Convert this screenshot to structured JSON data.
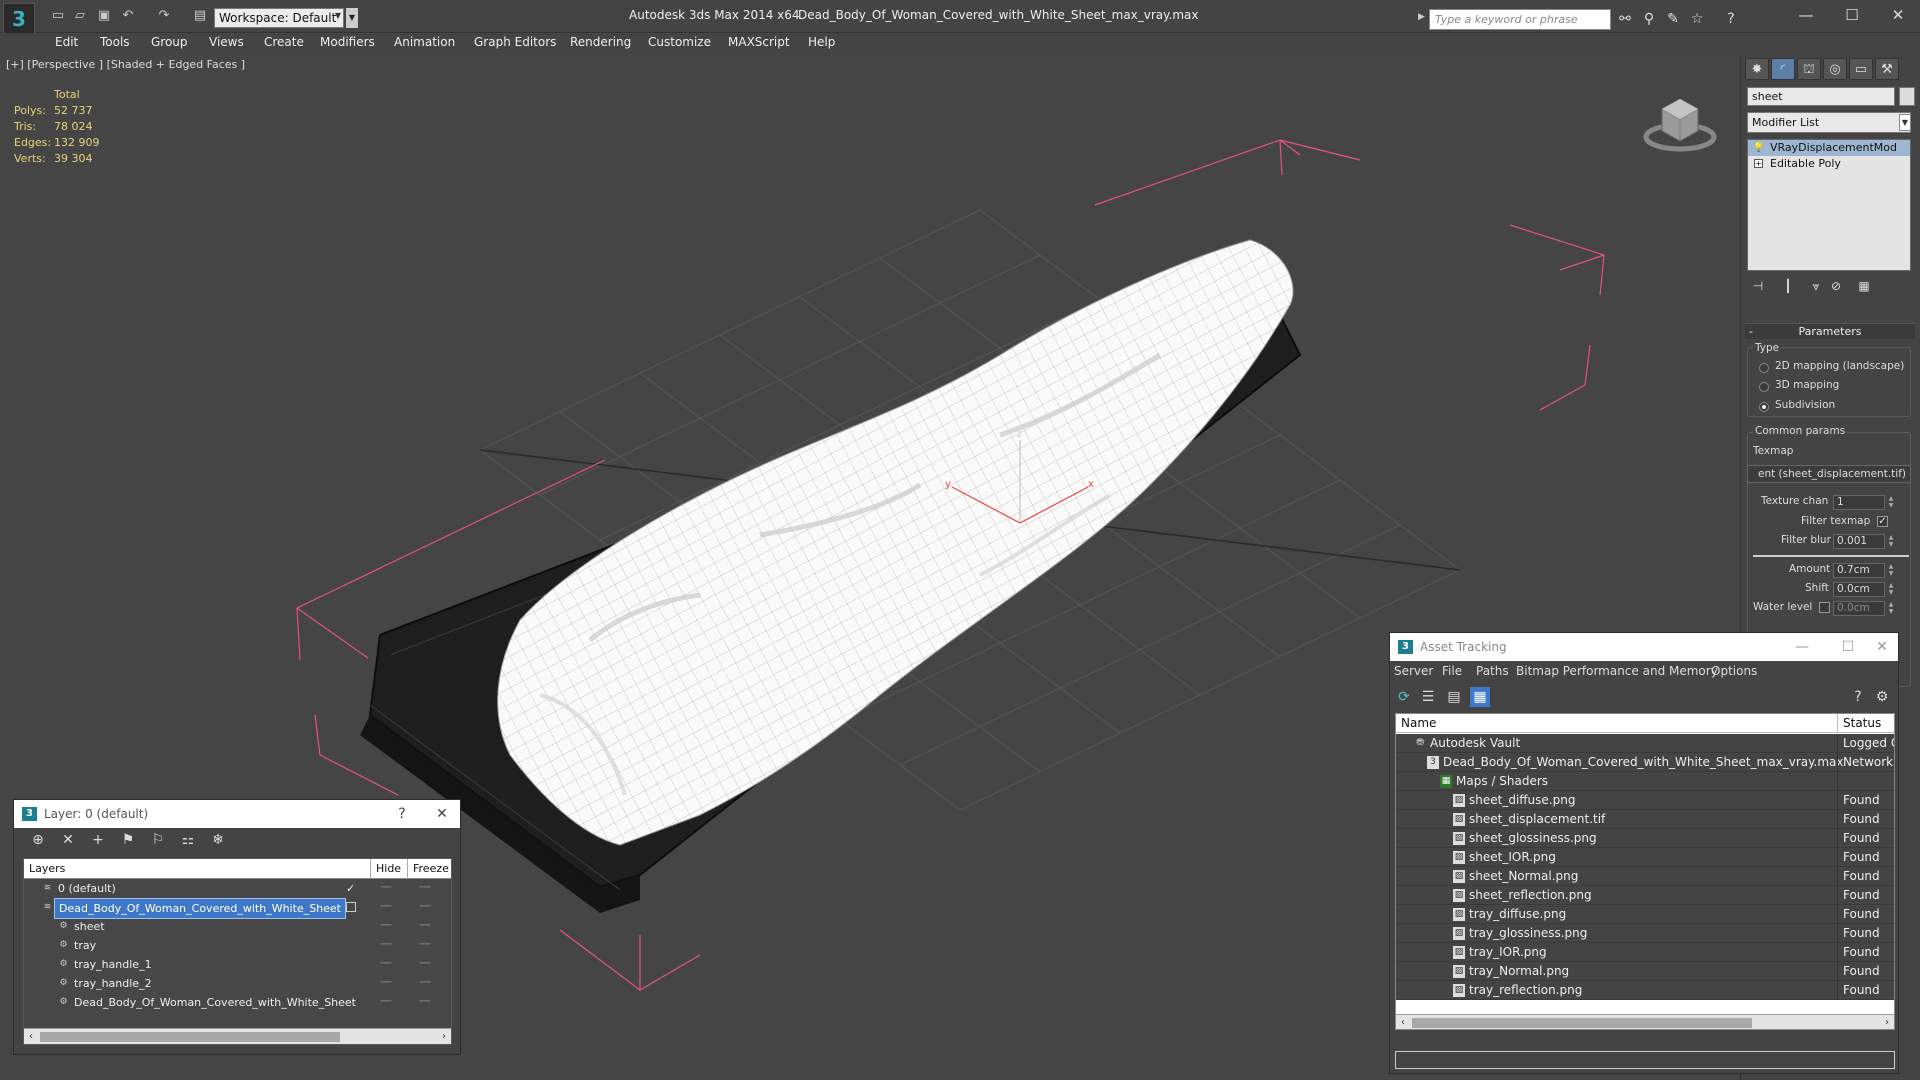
{
  "titlebar": {
    "workspace": "Workspace: Default",
    "app_name": "Autodesk 3ds Max  2014 x64",
    "file_name": "Dead_Body_Of_Woman_Covered_with_White_Sheet_max_vray.max",
    "search_placeholder": "Type a keyword or phrase",
    "win_minimize": "—",
    "win_maximize": "☐",
    "win_close": "✕"
  },
  "menu": [
    "Edit",
    "Tools",
    "Group",
    "Views",
    "Create",
    "Modifiers",
    "Animation",
    "Graph Editors",
    "Rendering",
    "Customize",
    "MAXScript",
    "Help"
  ],
  "viewport": {
    "label": "[+] [Perspective ] [Shaded + Edged Faces ]",
    "stats": {
      "total_label": "Total",
      "rows": [
        {
          "k": "Polys:",
          "v": "52 737"
        },
        {
          "k": "Tris:",
          "v": "78 024"
        },
        {
          "k": "Edges:",
          "v": "132 909"
        },
        {
          "k": "Verts:",
          "v": "39 304"
        }
      ]
    },
    "gizmo": {
      "x": "x",
      "y": "y",
      "z": "z"
    }
  },
  "command_panel": {
    "object_name": "sheet",
    "modifier_list": "Modifier List",
    "stack": [
      "VRayDisplacementMod",
      "Editable Poly"
    ],
    "rollout": "Parameters",
    "type_label": "Type",
    "types": [
      "2D mapping (landscape)",
      "3D mapping",
      "Subdivision"
    ],
    "common_params": "Common params",
    "texmap_label": "Texmap",
    "texmap_value": "ent (sheet_displacement.tif)",
    "texture_chan_label": "Texture chan",
    "texture_chan_value": "1",
    "filter_texmap_label": "Filter texmap",
    "filter_blur_label": "Filter blur",
    "filter_blur_value": "0.001",
    "amount_label": "Amount",
    "amount_value": "0.7cm",
    "shift_label": "Shift",
    "shift_value": "0.0cm",
    "water_level_label": "Water level",
    "water_level_value": "0.0cm"
  },
  "layer_window": {
    "title": "Layer: 0 (default)",
    "help": "?",
    "close": "✕",
    "col_layers": "Layers",
    "col_hide": "Hide",
    "col_freeze": "Freeze",
    "rows": [
      {
        "name": "0 (default)",
        "indent": 0
      },
      {
        "name": "Dead_Body_Of_Woman_Covered_with_White_Sheet",
        "indent": 0
      },
      {
        "name": "sheet",
        "indent": 1
      },
      {
        "name": "tray",
        "indent": 1
      },
      {
        "name": "tray_handle_1",
        "indent": 1
      },
      {
        "name": "tray_handle_2",
        "indent": 1
      },
      {
        "name": "Dead_Body_Of_Woman_Covered_with_White_Sheet",
        "indent": 1
      }
    ]
  },
  "asset_window": {
    "title": "Asset Tracking",
    "menu": [
      "Server",
      "File",
      "Paths",
      "Bitmap Performance and Memory",
      "Options"
    ],
    "col_name": "Name",
    "col_status": "Status",
    "rows": [
      {
        "name": "Autodesk Vault",
        "status": "Logged Out",
        "indent": 0
      },
      {
        "name": "Dead_Body_Of_Woman_Covered_with_White_Sheet_max_vray.max",
        "status": "Network Pa",
        "indent": 1
      },
      {
        "name": "Maps / Shaders",
        "status": "",
        "indent": 2
      },
      {
        "name": "sheet_diffuse.png",
        "status": "Found",
        "indent": 3
      },
      {
        "name": "sheet_displacement.tif",
        "status": "Found",
        "indent": 3
      },
      {
        "name": "sheet_glossiness.png",
        "status": "Found",
        "indent": 3
      },
      {
        "name": "sheet_IOR.png",
        "status": "Found",
        "indent": 3
      },
      {
        "name": "sheet_Normal.png",
        "status": "Found",
        "indent": 3
      },
      {
        "name": "sheet_reflection.png",
        "status": "Found",
        "indent": 3
      },
      {
        "name": "tray_diffuse.png",
        "status": "Found",
        "indent": 3
      },
      {
        "name": "tray_glossiness.png",
        "status": "Found",
        "indent": 3
      },
      {
        "name": "tray_IOR.png",
        "status": "Found",
        "indent": 3
      },
      {
        "name": "tray_Normal.png",
        "status": "Found",
        "indent": 3
      },
      {
        "name": "tray_reflection.png",
        "status": "Found",
        "indent": 3
      }
    ]
  }
}
